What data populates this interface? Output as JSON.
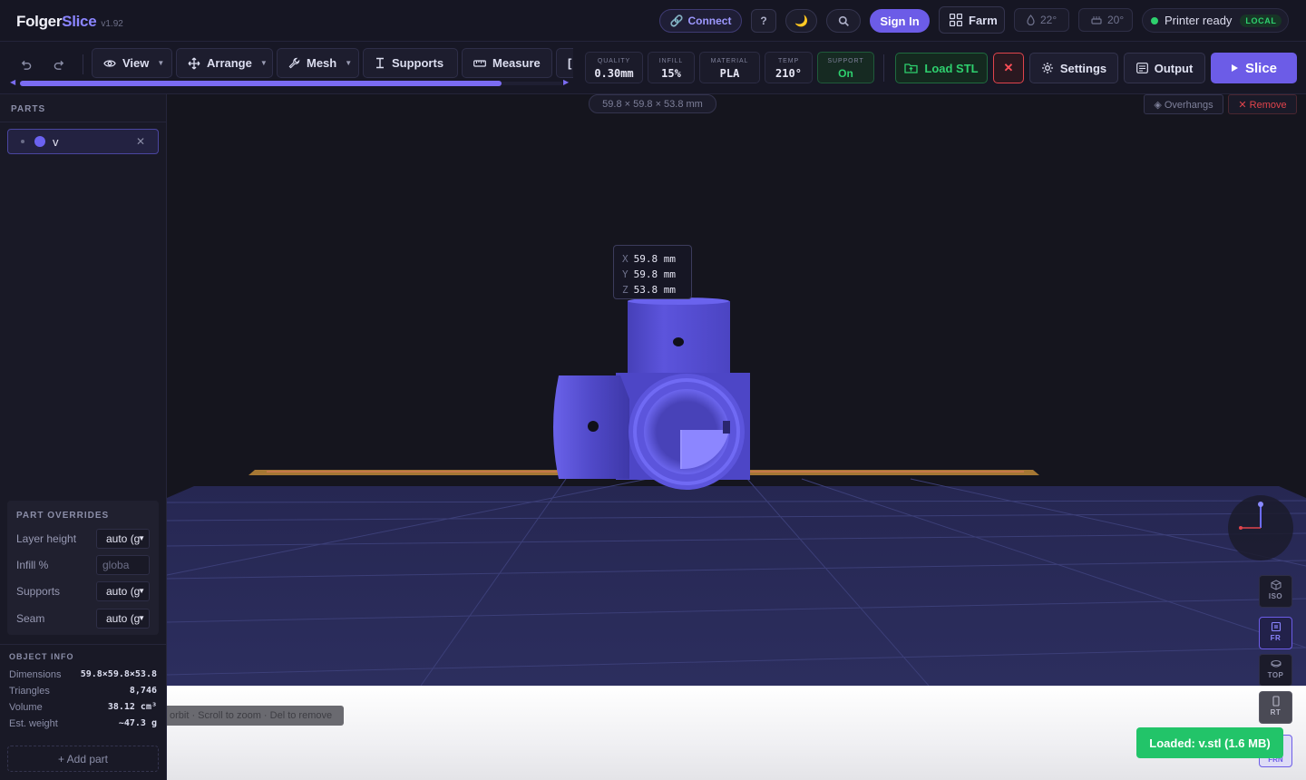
{
  "app": {
    "brand_main": "Folger",
    "brand_accent": "Slice",
    "version": "v1.92"
  },
  "topbar": {
    "connect": "Connect",
    "help": "?",
    "signin": "Sign In",
    "farm": "Farm",
    "nozzle_temp": "22°",
    "bed_temp": "20°",
    "status": "Printer ready",
    "status_badge": "LOCAL"
  },
  "toolbar": {
    "tools": [
      {
        "label": "View",
        "has_menu": true
      },
      {
        "label": "Arrange",
        "has_menu": true
      },
      {
        "label": "Mesh",
        "has_menu": true
      },
      {
        "label": "Supports",
        "has_menu": false
      },
      {
        "label": "Measure",
        "has_menu": false
      }
    ],
    "stats": [
      {
        "label": "QUALITY",
        "value": "0.30mm"
      },
      {
        "label": "INFILL",
        "value": "15%"
      },
      {
        "label": "MATERIAL",
        "value": "PLA"
      },
      {
        "label": "TEMP",
        "value": "210°"
      },
      {
        "label": "SUPPORT",
        "value": "On"
      }
    ],
    "load_stl": "Load STL",
    "close": "✕",
    "settings": "Settings",
    "output": "Output",
    "slice": "Slice"
  },
  "sidebar": {
    "parts_title": "PARTS",
    "parts": [
      {
        "name": "v",
        "color": "#6b62f0"
      }
    ],
    "overrides_title": "PART OVERRIDES",
    "overrides": [
      {
        "label": "Layer height",
        "value": "auto (g",
        "type": "select"
      },
      {
        "label": "Infill %",
        "value": "",
        "placeholder": "globa",
        "type": "input"
      },
      {
        "label": "Supports",
        "value": "auto (g",
        "type": "select"
      },
      {
        "label": "Seam",
        "value": "auto (g",
        "type": "select"
      }
    ],
    "info_title": "OBJECT INFO",
    "info": [
      {
        "label": "Dimensions",
        "value": "59.8×59.8×53.8"
      },
      {
        "label": "Triangles",
        "value": "8,746"
      },
      {
        "label": "Volume",
        "value": "38.12 cm³"
      },
      {
        "label": "Est. weight",
        "value": "~47.3 g"
      }
    ],
    "add_part": "+ Add part"
  },
  "viewport": {
    "dims_chip": "59.8 × 59.8 × 53.8 mm",
    "overhangs": "◈ Overhangs",
    "remove": "✕ Remove",
    "dimensions": [
      {
        "axis": "X",
        "value": "59.8",
        "unit": "mm"
      },
      {
        "axis": "Y",
        "value": "59.8",
        "unit": "mm"
      },
      {
        "axis": "Z",
        "value": "53.8",
        "unit": "mm"
      }
    ],
    "view_buttons": [
      "ISO",
      "FR",
      "TOP",
      "RT"
    ],
    "active_view": "FR",
    "hint": "orbit · Scroll to zoom · Del to remove",
    "toast": "Loaded: v.stl (1.6 MB)",
    "bottom_button": "FRN",
    "colors": {
      "model": "#5a52d6",
      "accent": "#6c5ce7",
      "success": "#22c469"
    }
  }
}
